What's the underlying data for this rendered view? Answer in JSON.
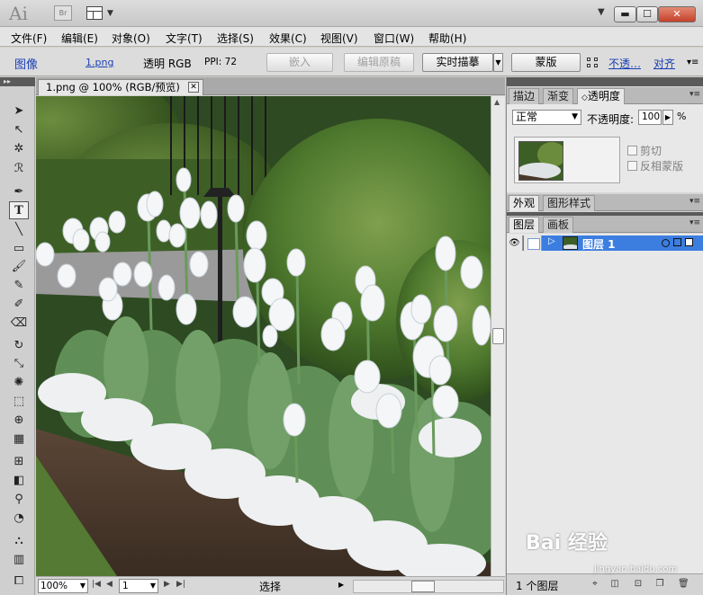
{
  "app": {
    "logo": "Ai",
    "bridge_label": "Br",
    "window_controls": {
      "minimize": "▬",
      "maximize": "☐",
      "close": "✕"
    }
  },
  "menubar": [
    "文件(F)",
    "编辑(E)",
    "对象(O)",
    "文字(T)",
    "选择(S)",
    "效果(C)",
    "视图(V)",
    "窗口(W)",
    "帮助(H)"
  ],
  "controlbar": {
    "object_type": "图像",
    "file_link": "1.png",
    "color_mode": "透明 RGB",
    "ppi": "PPI: 72",
    "embed_button": "嵌入",
    "edit_original_button": "编辑原稿",
    "live_trace_button": "实时描摹",
    "mask_button": "蒙版",
    "opacity_link": "不透…",
    "align_link": "对齐"
  },
  "document": {
    "tab_title": "1.png @ 100% (RGB/预览)"
  },
  "statusbar": {
    "zoom": "100%",
    "page": "1",
    "status": "选择"
  },
  "panels": {
    "transparency": {
      "tabs": [
        "描边",
        "渐变",
        "透明度"
      ],
      "active_tab": 2,
      "blend_mode": "正常",
      "opacity_label": "不透明度:",
      "opacity_value": "100",
      "opacity_unit": "%",
      "clip_label": "剪切",
      "invert_mask_label": "反相蒙版"
    },
    "appearance": {
      "tabs": [
        "外观",
        "图形样式"
      ]
    },
    "layers": {
      "tabs": [
        "图层",
        "画板"
      ],
      "layer_name": "图层 1",
      "layer_count": "1 个图层"
    }
  },
  "watermark": {
    "text": "Bai 经验",
    "sub": "jingyan.baidu.com"
  },
  "colors": {
    "selection_blue": "#3c7ee0",
    "link_blue": "#1a3fb4",
    "close_red": "#c5412a"
  },
  "icons": {
    "toolbox": [
      "selection-arrow-icon",
      "direct-selection-icon",
      "magic-wand-icon",
      "lasso-icon",
      "pen-icon",
      "type-icon",
      "line-icon",
      "rectangle-icon",
      "paintbrush-icon",
      "pencil-icon",
      "blob-brush-icon",
      "eraser-icon",
      "rotate-icon",
      "scale-icon",
      "warp-icon",
      "free-transform-icon",
      "shape-builder-icon",
      "perspective-grid-icon",
      "mesh-icon",
      "gradient-icon",
      "eyedropper-icon",
      "blend-icon",
      "symbol-sprayer-icon",
      "column-graph-icon",
      "artboard-icon"
    ]
  }
}
